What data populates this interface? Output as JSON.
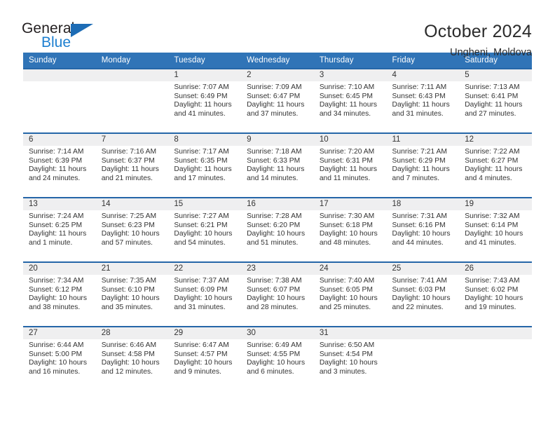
{
  "brand": {
    "name_top": "General",
    "name_bottom": "Blue",
    "triangle_color": "#1d6cb5",
    "blue_text_color": "#1d7fd0"
  },
  "header": {
    "title": "October 2024",
    "subtitle": "Ungheni, Moldova"
  },
  "theme": {
    "header_row_bg": "#3074b7",
    "week_separator": "#2566a8",
    "daynum_bg": "#efeff0",
    "text": "#333333"
  },
  "weekday_headers": [
    "Sunday",
    "Monday",
    "Tuesday",
    "Wednesday",
    "Thursday",
    "Friday",
    "Saturday"
  ],
  "weeks": [
    [
      {
        "day": "",
        "details": ""
      },
      {
        "day": "",
        "details": ""
      },
      {
        "day": "1",
        "details": "Sunrise: 7:07 AM\nSunset: 6:49 PM\nDaylight: 11 hours\nand 41 minutes."
      },
      {
        "day": "2",
        "details": "Sunrise: 7:09 AM\nSunset: 6:47 PM\nDaylight: 11 hours\nand 37 minutes."
      },
      {
        "day": "3",
        "details": "Sunrise: 7:10 AM\nSunset: 6:45 PM\nDaylight: 11 hours\nand 34 minutes."
      },
      {
        "day": "4",
        "details": "Sunrise: 7:11 AM\nSunset: 6:43 PM\nDaylight: 11 hours\nand 31 minutes."
      },
      {
        "day": "5",
        "details": "Sunrise: 7:13 AM\nSunset: 6:41 PM\nDaylight: 11 hours\nand 27 minutes."
      }
    ],
    [
      {
        "day": "6",
        "details": "Sunrise: 7:14 AM\nSunset: 6:39 PM\nDaylight: 11 hours\nand 24 minutes."
      },
      {
        "day": "7",
        "details": "Sunrise: 7:16 AM\nSunset: 6:37 PM\nDaylight: 11 hours\nand 21 minutes."
      },
      {
        "day": "8",
        "details": "Sunrise: 7:17 AM\nSunset: 6:35 PM\nDaylight: 11 hours\nand 17 minutes."
      },
      {
        "day": "9",
        "details": "Sunrise: 7:18 AM\nSunset: 6:33 PM\nDaylight: 11 hours\nand 14 minutes."
      },
      {
        "day": "10",
        "details": "Sunrise: 7:20 AM\nSunset: 6:31 PM\nDaylight: 11 hours\nand 11 minutes."
      },
      {
        "day": "11",
        "details": "Sunrise: 7:21 AM\nSunset: 6:29 PM\nDaylight: 11 hours\nand 7 minutes."
      },
      {
        "day": "12",
        "details": "Sunrise: 7:22 AM\nSunset: 6:27 PM\nDaylight: 11 hours\nand 4 minutes."
      }
    ],
    [
      {
        "day": "13",
        "details": "Sunrise: 7:24 AM\nSunset: 6:25 PM\nDaylight: 11 hours\nand 1 minute."
      },
      {
        "day": "14",
        "details": "Sunrise: 7:25 AM\nSunset: 6:23 PM\nDaylight: 10 hours\nand 57 minutes."
      },
      {
        "day": "15",
        "details": "Sunrise: 7:27 AM\nSunset: 6:21 PM\nDaylight: 10 hours\nand 54 minutes."
      },
      {
        "day": "16",
        "details": "Sunrise: 7:28 AM\nSunset: 6:20 PM\nDaylight: 10 hours\nand 51 minutes."
      },
      {
        "day": "17",
        "details": "Sunrise: 7:30 AM\nSunset: 6:18 PM\nDaylight: 10 hours\nand 48 minutes."
      },
      {
        "day": "18",
        "details": "Sunrise: 7:31 AM\nSunset: 6:16 PM\nDaylight: 10 hours\nand 44 minutes."
      },
      {
        "day": "19",
        "details": "Sunrise: 7:32 AM\nSunset: 6:14 PM\nDaylight: 10 hours\nand 41 minutes."
      }
    ],
    [
      {
        "day": "20",
        "details": "Sunrise: 7:34 AM\nSunset: 6:12 PM\nDaylight: 10 hours\nand 38 minutes."
      },
      {
        "day": "21",
        "details": "Sunrise: 7:35 AM\nSunset: 6:10 PM\nDaylight: 10 hours\nand 35 minutes."
      },
      {
        "day": "22",
        "details": "Sunrise: 7:37 AM\nSunset: 6:09 PM\nDaylight: 10 hours\nand 31 minutes."
      },
      {
        "day": "23",
        "details": "Sunrise: 7:38 AM\nSunset: 6:07 PM\nDaylight: 10 hours\nand 28 minutes."
      },
      {
        "day": "24",
        "details": "Sunrise: 7:40 AM\nSunset: 6:05 PM\nDaylight: 10 hours\nand 25 minutes."
      },
      {
        "day": "25",
        "details": "Sunrise: 7:41 AM\nSunset: 6:03 PM\nDaylight: 10 hours\nand 22 minutes."
      },
      {
        "day": "26",
        "details": "Sunrise: 7:43 AM\nSunset: 6:02 PM\nDaylight: 10 hours\nand 19 minutes."
      }
    ],
    [
      {
        "day": "27",
        "details": "Sunrise: 6:44 AM\nSunset: 5:00 PM\nDaylight: 10 hours\nand 16 minutes."
      },
      {
        "day": "28",
        "details": "Sunrise: 6:46 AM\nSunset: 4:58 PM\nDaylight: 10 hours\nand 12 minutes."
      },
      {
        "day": "29",
        "details": "Sunrise: 6:47 AM\nSunset: 4:57 PM\nDaylight: 10 hours\nand 9 minutes."
      },
      {
        "day": "30",
        "details": "Sunrise: 6:49 AM\nSunset: 4:55 PM\nDaylight: 10 hours\nand 6 minutes."
      },
      {
        "day": "31",
        "details": "Sunrise: 6:50 AM\nSunset: 4:54 PM\nDaylight: 10 hours\nand 3 minutes."
      },
      {
        "day": "",
        "details": ""
      },
      {
        "day": "",
        "details": ""
      }
    ]
  ]
}
